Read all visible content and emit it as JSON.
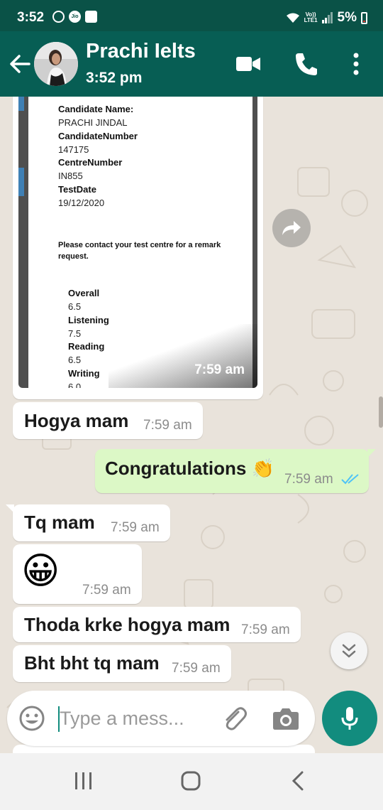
{
  "status_bar": {
    "time": "3:52",
    "icon_1": "circle-icon",
    "carrier_badge": "Jio",
    "icon_3": "square-icon",
    "volte_top": "Vo))",
    "volte_bottom": "LTE1",
    "battery": "5%"
  },
  "header": {
    "contact_name": "Prachi Ielts",
    "last_seen": "3:52 pm",
    "colors": {
      "header": "#075e54",
      "status_bar": "#0a5247"
    }
  },
  "image_message": {
    "doc": {
      "candidate_name_label": "Candidate Name:",
      "candidate_name": "PRACHI JINDAL",
      "candidate_number_label": "CandidateNumber",
      "candidate_number": "147175",
      "centre_number_label": "CentreNumber",
      "centre_number": "IN855",
      "test_date_label": "TestDate",
      "test_date": "19/12/2020",
      "note": "Please contact your test centre for a remark request.",
      "overall_label": "Overall",
      "overall": "6.5",
      "listening_label": "Listening",
      "listening": "7.5",
      "reading_label": "Reading",
      "reading": "6.5",
      "writing_label": "Writing",
      "writing": "6.0"
    },
    "time": "7:59 am"
  },
  "messages": [
    {
      "direction": "in",
      "text": "Hogya mam",
      "time": "7:59 am"
    },
    {
      "direction": "out",
      "text": "Congratulations 👏",
      "time": "7:59 am",
      "status": "read"
    },
    {
      "direction": "in",
      "text": "Tq mam",
      "time": "7:59 am"
    },
    {
      "direction": "in",
      "text": "😀",
      "time": "7:59 am"
    },
    {
      "direction": "in",
      "text": "Thoda krke hogya mam",
      "time": "7:59 am"
    },
    {
      "direction": "in",
      "text": "Bht bht tq mam",
      "time": "7:59 am"
    }
  ],
  "input": {
    "placeholder": "Type a mess..."
  },
  "colors": {
    "chat_bg": "#e9e3db",
    "outgoing_bubble": "#dcf8c6",
    "accent": "#128c7e",
    "read_ticks": "#4fc3f7"
  }
}
